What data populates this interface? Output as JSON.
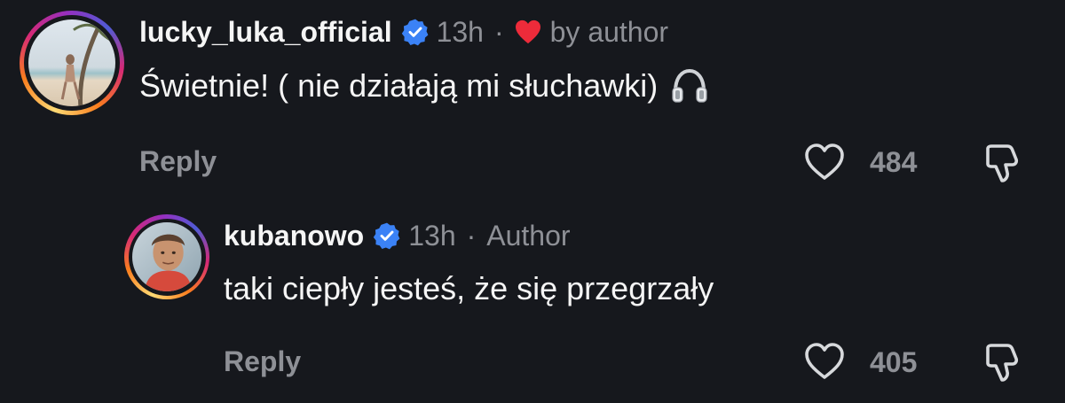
{
  "comments": [
    {
      "username": "lucky_luka_official",
      "verified": true,
      "time": "13h",
      "dot": "·",
      "liked_by_author_label": "by author",
      "text": "Świetnie! ( nie działają mi słuchawki)",
      "emoji_icon": "headphones-icon",
      "reply_label": "Reply",
      "likes": "484"
    },
    {
      "username": "kubanowo",
      "verified": true,
      "time": "13h",
      "dot": "·",
      "author_label": "Author",
      "text": "taki ciepły jesteś, że się przegrzały",
      "reply_label": "Reply",
      "likes": "405"
    }
  ],
  "colors": {
    "background": "#16181d",
    "verified_blue": "#3b82f6",
    "heart_red": "#ed2b3a",
    "muted_text": "#8e9096"
  }
}
